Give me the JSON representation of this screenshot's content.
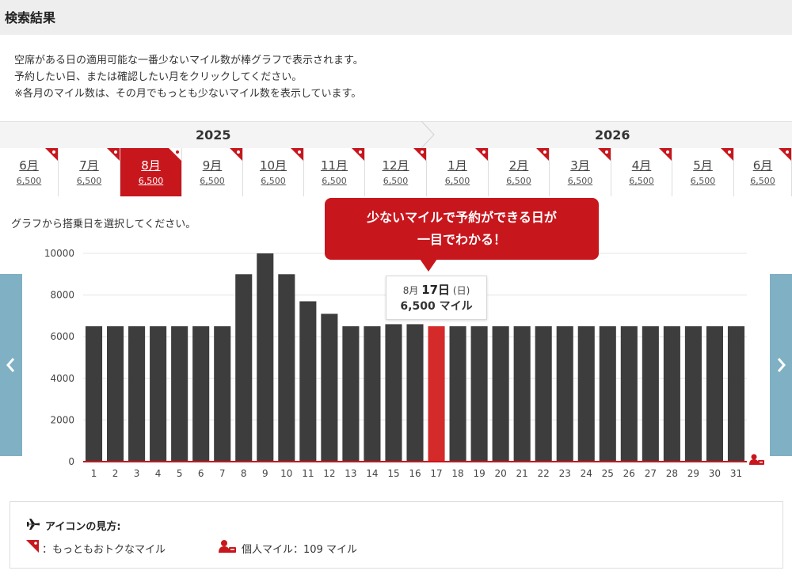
{
  "header": {
    "title": "検索結果"
  },
  "description": [
    "空席がある日の適用可能な一番少ないマイル数が棒グラフで表示されます。",
    "予約したい日、または確認したい月をクリックしてください。",
    "※各月のマイル数は、その月でもっとも少ないマイル数を表示しています。"
  ],
  "years": [
    "2025",
    "2026"
  ],
  "months": [
    {
      "name": "6月",
      "miles": "6,500",
      "selected": false
    },
    {
      "name": "7月",
      "miles": "6,500",
      "selected": false
    },
    {
      "name": "8月",
      "miles": "6,500",
      "selected": true
    },
    {
      "name": "9月",
      "miles": "6,500",
      "selected": false
    },
    {
      "name": "10月",
      "miles": "6,500",
      "selected": false
    },
    {
      "name": "11月",
      "miles": "6,500",
      "selected": false
    },
    {
      "name": "12月",
      "miles": "6,500",
      "selected": false
    },
    {
      "name": "1月",
      "miles": "6,500",
      "selected": false
    },
    {
      "name": "2月",
      "miles": "6,500",
      "selected": false
    },
    {
      "name": "3月",
      "miles": "6,500",
      "selected": false
    },
    {
      "name": "4月",
      "miles": "6,500",
      "selected": false
    },
    {
      "name": "5月",
      "miles": "6,500",
      "selected": false
    },
    {
      "name": "6月",
      "miles": "6,500",
      "selected": false
    }
  ],
  "select_hint": "グラフから搭乗日を選択してください。",
  "callout": {
    "line1": "少ないマイルで予約ができる日が",
    "line2": "一目でわかる！"
  },
  "tooltip": {
    "month": "8月",
    "day": "17日",
    "weekday": "(日)",
    "miles": "6,500 マイル"
  },
  "colors": {
    "accent": "#c8161d",
    "bar": "#3d3d3d",
    "selected_bar": "#d42a2a",
    "nav": "#7fb0c4"
  },
  "chart_data": {
    "type": "bar",
    "categories": [
      "1",
      "2",
      "3",
      "4",
      "5",
      "6",
      "7",
      "8",
      "9",
      "10",
      "11",
      "12",
      "13",
      "14",
      "15",
      "16",
      "17",
      "18",
      "19",
      "20",
      "21",
      "22",
      "23",
      "24",
      "25",
      "26",
      "27",
      "28",
      "29",
      "30",
      "31"
    ],
    "values": [
      6500,
      6500,
      6500,
      6500,
      6500,
      6500,
      6500,
      9000,
      10000,
      9000,
      7700,
      7100,
      6500,
      6500,
      6600,
      6600,
      6500,
      6500,
      6500,
      6500,
      6500,
      6500,
      6500,
      6500,
      6500,
      6500,
      6500,
      6500,
      6500,
      6500,
      6500
    ],
    "selected_category": "17",
    "yticks": [
      "0",
      "2000",
      "4000",
      "6000",
      "8000",
      "10000"
    ],
    "ylim": [
      0,
      10000
    ],
    "grid": true
  },
  "legend": {
    "title": "アイコンの見方:",
    "deal_text": "：もっともおトクなマイル",
    "personal_text": "個人マイル：109 マイル"
  }
}
